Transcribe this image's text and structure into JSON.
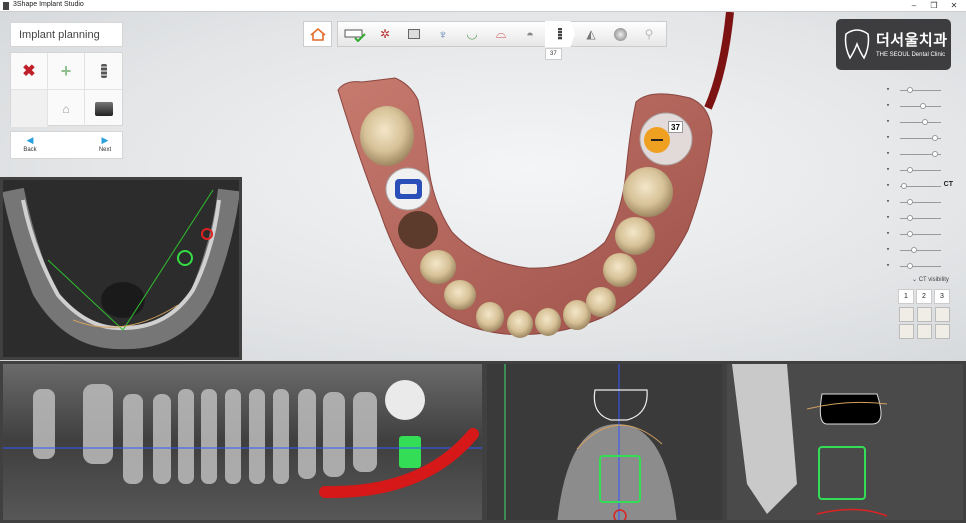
{
  "window": {
    "title": "3Shape Implant Studio",
    "controls": [
      "–",
      "❒",
      "✕"
    ]
  },
  "left_panel": {
    "title": "Implant planning",
    "tools": [
      {
        "icon": "delete-x-icon"
      },
      {
        "icon": "add-plus-icon"
      },
      {
        "icon": "implant-icon"
      },
      {
        "icon": "blank"
      },
      {
        "icon": "abutment-icon"
      },
      {
        "icon": "sleeve-icon"
      }
    ],
    "nav": {
      "back_label": "Back",
      "next_label": "Next"
    }
  },
  "toolbar": {
    "items": [
      "home-icon",
      "scan-check-icon",
      "teeth-setup-icon",
      "panorama-icon",
      "implant-library-icon",
      "nerve-icon",
      "crown-icon",
      "tooth-icon",
      "implant-step-icon",
      "guide-icon",
      "sphere-icon",
      "next-step-icon"
    ],
    "active_tooltip": "37"
  },
  "logo": {
    "name": "더서울치과",
    "subtitle": "THE SEOUL Dental Clinic"
  },
  "tooth_label": {
    "value": "37"
  },
  "right_panel": {
    "sliders": [
      {
        "icon": "implant-visibility-icon",
        "level": 0.25
      },
      {
        "icon": "guide-visibility-icon",
        "level": 0.55
      },
      {
        "icon": "scan-visibility-icon",
        "level": 0.6
      },
      {
        "icon": "sleeve-visibility-icon",
        "level": 0.85
      },
      {
        "icon": "abutment-visibility-icon",
        "level": 0.85
      },
      {
        "icon": "nerve-visibility-icon",
        "level": 0.25
      },
      {
        "icon": "ct-visibility-icon",
        "level": 0.1,
        "label": "CT"
      },
      {
        "icon": "teeth-visibility-icon",
        "level": 0.25
      },
      {
        "icon": "gum-visibility-icon",
        "level": 0.25
      },
      {
        "icon": "crown-visibility-icon",
        "level": 0.25
      },
      {
        "icon": "brightness-icon",
        "level": 0.35
      },
      {
        "icon": "contrast-icon",
        "level": 0.25
      }
    ],
    "ct_visibility_label": "CT visibility",
    "ct_tabs": [
      "1",
      "2",
      "3"
    ]
  },
  "colors": {
    "accent": "#2aa0dd",
    "implant_green": "#33dd55",
    "nerve_red": "#d61818",
    "gum": "#b56a5e",
    "crosshair_blue": "#3555ff"
  }
}
